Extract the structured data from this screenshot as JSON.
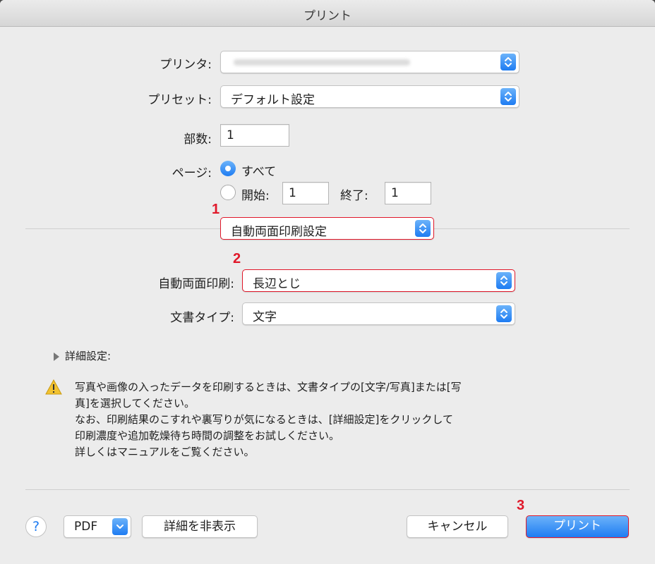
{
  "window": {
    "title": "プリント"
  },
  "printer": {
    "label": "プリンタ:",
    "value": ""
  },
  "preset": {
    "label": "プリセット:",
    "value": "デフォルト設定"
  },
  "copies": {
    "label": "部数:",
    "value": "1"
  },
  "pages": {
    "label": "ページ:",
    "all_label": "すべて",
    "from_label": "開始:",
    "from_value": "1",
    "to_label": "終了:",
    "to_value": "1",
    "selected": "all"
  },
  "panel_select": {
    "value": "自動両面印刷設定"
  },
  "duplex": {
    "label": "自動両面印刷:",
    "value": "長辺とじ"
  },
  "doc_type": {
    "label": "文書タイプ:",
    "value": "文字"
  },
  "advanced": {
    "label": "詳細設定:",
    "expanded": false
  },
  "notice": {
    "lines": [
      "写真や画像の入ったデータを印刷するときは、文書タイプの[文字/写真]または[写",
      "真]を選択してください。",
      "なお、印刷結果のこすれや裏写りが気になるときは、[詳細設定]をクリックして",
      "印刷濃度や追加乾燥待ち時間の調整をお試しください。",
      "詳しくはマニュアルをご覧ください。"
    ]
  },
  "footer": {
    "help_label": "?",
    "pdf_label": "PDF",
    "hide_details_label": "詳細を非表示",
    "cancel_label": "キャンセル",
    "print_label": "プリント"
  },
  "annotations": {
    "m1": "1",
    "m2": "2",
    "m3": "3"
  },
  "colors": {
    "accent": "#1e7cf2",
    "highlight": "#e0182a",
    "background": "#ececec"
  },
  "icons": {
    "stepper": "up-down-chevron-icon",
    "warning": "warning-icon",
    "disclosure": "disclosure-triangle-icon"
  }
}
